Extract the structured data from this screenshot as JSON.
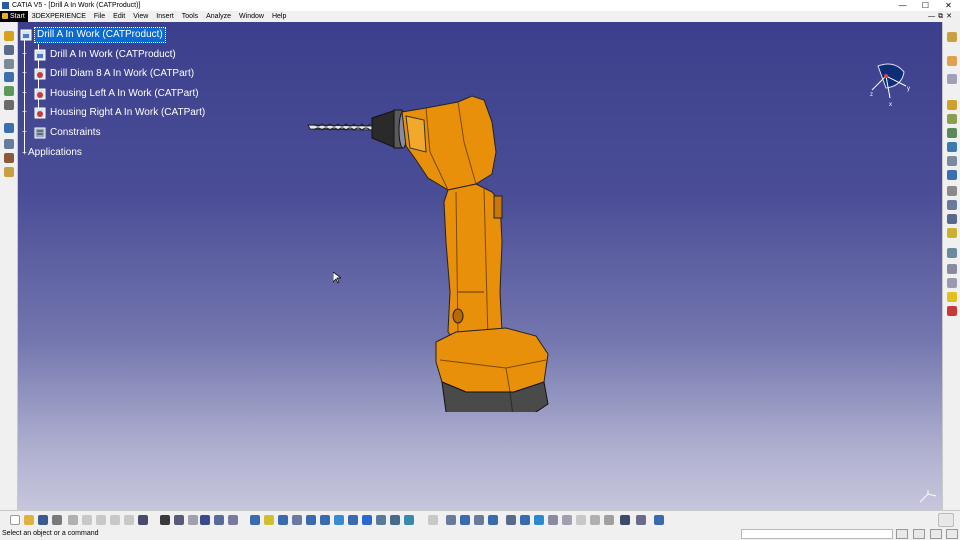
{
  "window": {
    "title": "CATIA V5 - [Drill A In Work (CATProduct)]",
    "controls": {
      "minimize": "—",
      "maximize": "☐",
      "close": "✕"
    }
  },
  "menubar": {
    "items": [
      "Start",
      "3DEXPERIENCE",
      "File",
      "Edit",
      "View",
      "Insert",
      "Tools",
      "Analyze",
      "Window",
      "Help"
    ],
    "mdi": {
      "minimize": "—",
      "restore": "⧉",
      "close": "✕"
    }
  },
  "tree": {
    "root": "Drill A In Work (CATProduct)",
    "children": [
      "Drill A In Work (CATProduct)",
      "Drill Diam 8 A In Work (CATPart)",
      "Housing Left A In Work (CATPart)",
      "Housing Right A In Work (CATPart)",
      "Constraints"
    ],
    "applications": "Applications"
  },
  "compass": {
    "x_label": "x",
    "y_label": "y",
    "z_label": "z"
  },
  "statusbar": {
    "message": "Select an object or a command",
    "command_value": ""
  },
  "colors": {
    "viewport_top": "#3c3f8c",
    "viewport_bottom": "#c6c6dc",
    "selection": "#0a6ad2",
    "drill_body": "#e8900a",
    "battery": "#4a4a4a"
  },
  "icons": {
    "left_toolbar": [
      "assembly-icon",
      "refresh-icon",
      "product-icon",
      "component-icon",
      "replace-icon",
      "graph-icon",
      "reorder-icon",
      "multi-icon",
      "catalog-icon",
      "publish-icon"
    ],
    "right_toolbar": [
      "workbench-icon",
      "sketch-icon",
      "move-icon",
      "snap-icon",
      "explode-icon",
      "stop-icon",
      "constraint-icon",
      "contact-icon",
      "offset-icon",
      "angle-icon",
      "fix-icon",
      "coincidence-icon",
      "update-icon",
      "catalog-icon",
      "scene-icon",
      "clash-icon",
      "measure-icon",
      "light-icon",
      "delete-icon"
    ],
    "bottom_toolbar": [
      "new-icon",
      "open-icon",
      "save-icon",
      "print-icon",
      "cut-icon",
      "copy-icon",
      "paste-icon",
      "undo-icon",
      "redo-icon",
      "help-icon",
      "formula-icon",
      "comment-icon",
      "sensor-icon",
      "fly-icon",
      "fit-all-icon",
      "pan-icon",
      "rotate-icon",
      "zoom-in-icon",
      "zoom-out-icon",
      "normal-view-icon",
      "iso-view-icon",
      "shading-icon",
      "hide-icon",
      "swap-icon",
      "measure-icon",
      "section-icon",
      "clash-icon",
      "update-icon",
      "catalog-icon"
    ]
  }
}
